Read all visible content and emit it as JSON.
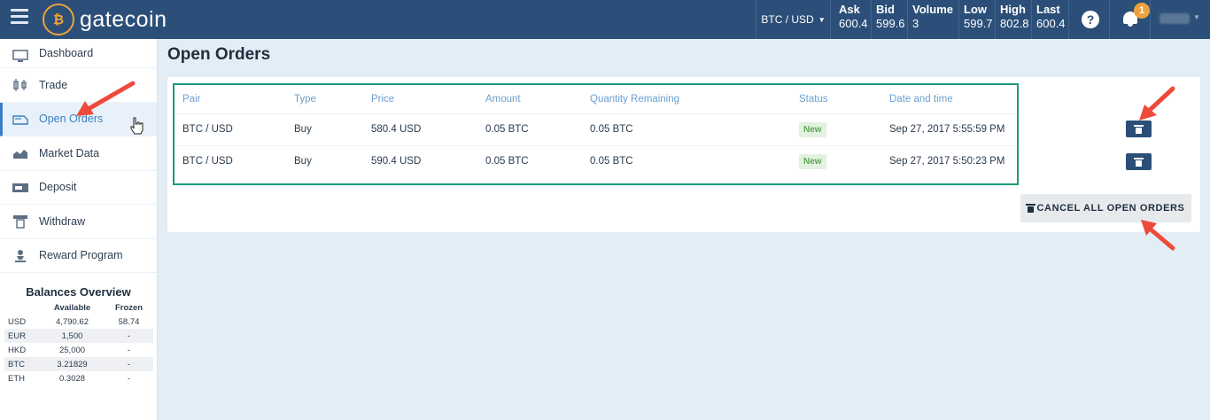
{
  "app": {
    "logo_mark": "₿",
    "logo_text": "gatecoin"
  },
  "market": {
    "pair": "BTC / USD",
    "stats": [
      {
        "label": "Ask",
        "value": "600.4"
      },
      {
        "label": "Bid",
        "value": "599.6"
      },
      {
        "label": "Volume",
        "value": "3"
      },
      {
        "label": "Low",
        "value": "599.7"
      },
      {
        "label": "High",
        "value": "802.8"
      },
      {
        "label": "Last",
        "value": "600.4"
      }
    ]
  },
  "header": {
    "help_label": "?",
    "notification_count": "1"
  },
  "sidebar": {
    "items": [
      {
        "label": "Dashboard",
        "icon": "monitor-icon"
      },
      {
        "label": "Trade",
        "icon": "candlestick-icon"
      },
      {
        "label": "Open Orders",
        "icon": "orders-icon"
      },
      {
        "label": "Market Data",
        "icon": "area-chart-icon"
      },
      {
        "label": "Deposit",
        "icon": "deposit-icon"
      },
      {
        "label": "Withdraw",
        "icon": "withdraw-icon"
      },
      {
        "label": "Reward Program",
        "icon": "reward-icon"
      }
    ]
  },
  "balances": {
    "title": "Balances Overview",
    "headers": [
      "",
      "Available",
      "Frozen"
    ],
    "rows": [
      [
        "USD",
        "4,790.62",
        "58.74"
      ],
      [
        "EUR",
        "1,500",
        "-"
      ],
      [
        "HKD",
        "25,000",
        "-"
      ],
      [
        "BTC",
        "3.21829",
        "-"
      ],
      [
        "ETH",
        "0.3028",
        "-"
      ]
    ]
  },
  "page": {
    "title": "Open Orders"
  },
  "orders": {
    "columns": [
      "Pair",
      "Type",
      "Price",
      "Amount",
      "Quantity Remaining",
      "Status",
      "Date and time"
    ],
    "rows": [
      [
        "BTC / USD",
        "Buy",
        "580.4 USD",
        "0.05 BTC",
        "0.05 BTC",
        "New",
        "Sep 27, 2017 5:55:59 PM"
      ],
      [
        "BTC / USD",
        "Buy",
        "590.4 USD",
        "0.05 BTC",
        "0.05 BTC",
        "New",
        "Sep 27, 2017 5:50:23 PM"
      ]
    ],
    "cancel_all_label": "CANCEL ALL OPEN ORDERS"
  },
  "colors": {
    "topbar": "#2b4f78",
    "accent": "#3a7fc1",
    "highlight_box": "#1a9a7d",
    "annotation_arrow": "#ee4a3b",
    "badge": "#f0a23a"
  }
}
